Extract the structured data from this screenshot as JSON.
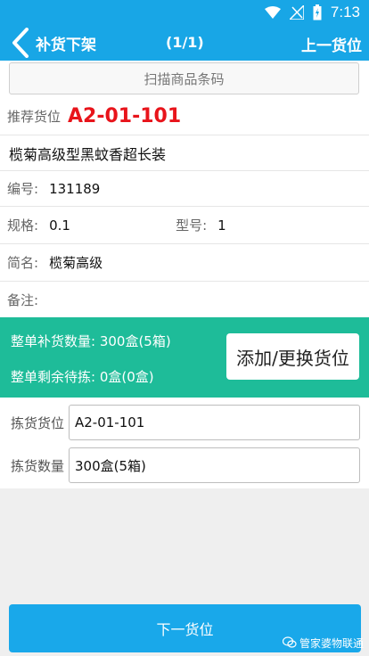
{
  "status_bar": {
    "time": "7:13",
    "icons": [
      "wifi-icon",
      "signal-icon",
      "battery-icon"
    ]
  },
  "header": {
    "back_label": "补货下架",
    "page_count": "(1/1)",
    "prev_label": "上一货位"
  },
  "scan": {
    "label": "扫描商品条码"
  },
  "details": {
    "recommend_label": "推荐货位",
    "recommend_value": "A2-01-101",
    "product_name": "榄菊高级型黑蚊香超长装",
    "code_label": "编号:",
    "code_value": "131189",
    "spec_label": "规格:",
    "spec_value": "0.1",
    "model_label": "型号:",
    "model_value": "1",
    "short_label": "简名:",
    "short_value": "榄菊高级",
    "note_label": "备注:"
  },
  "summary": {
    "replenish_text": "整单补货数量: 300盒(5箱)",
    "remaining_text": "整单剩余待拣: 0盒(0盒)",
    "swap_button": "添加/更换货位"
  },
  "form": {
    "location_label": "拣货货位",
    "location_value": "A2-01-101",
    "qty_label": "拣货数量",
    "qty_value": "300盒(5箱)"
  },
  "footer": {
    "next_label": "下一货位",
    "watermark": "管家婆物联通"
  },
  "colors": {
    "primary": "#18a6e6",
    "green": "#1ebc99",
    "red": "#e8141b"
  }
}
